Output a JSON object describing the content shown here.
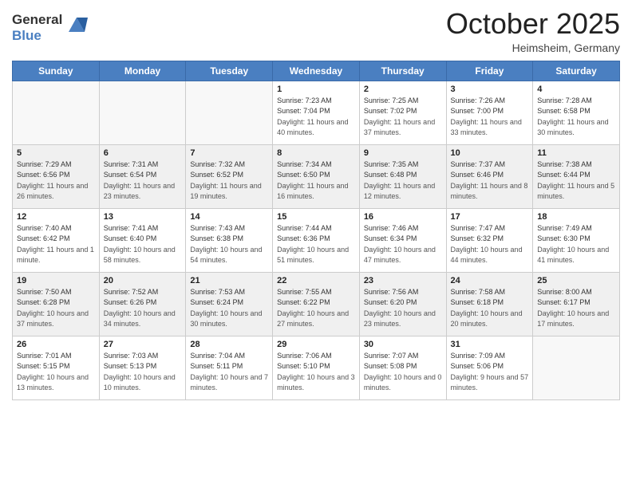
{
  "header": {
    "logo_line1": "General",
    "logo_line2": "Blue",
    "title": "October 2025",
    "subtitle": "Heimsheim, Germany"
  },
  "days_of_week": [
    "Sunday",
    "Monday",
    "Tuesday",
    "Wednesday",
    "Thursday",
    "Friday",
    "Saturday"
  ],
  "weeks": [
    [
      {
        "day": "",
        "info": ""
      },
      {
        "day": "",
        "info": ""
      },
      {
        "day": "",
        "info": ""
      },
      {
        "day": "1",
        "info": "Sunrise: 7:23 AM\nSunset: 7:04 PM\nDaylight: 11 hours and 40 minutes."
      },
      {
        "day": "2",
        "info": "Sunrise: 7:25 AM\nSunset: 7:02 PM\nDaylight: 11 hours and 37 minutes."
      },
      {
        "day": "3",
        "info": "Sunrise: 7:26 AM\nSunset: 7:00 PM\nDaylight: 11 hours and 33 minutes."
      },
      {
        "day": "4",
        "info": "Sunrise: 7:28 AM\nSunset: 6:58 PM\nDaylight: 11 hours and 30 minutes."
      }
    ],
    [
      {
        "day": "5",
        "info": "Sunrise: 7:29 AM\nSunset: 6:56 PM\nDaylight: 11 hours and 26 minutes."
      },
      {
        "day": "6",
        "info": "Sunrise: 7:31 AM\nSunset: 6:54 PM\nDaylight: 11 hours and 23 minutes."
      },
      {
        "day": "7",
        "info": "Sunrise: 7:32 AM\nSunset: 6:52 PM\nDaylight: 11 hours and 19 minutes."
      },
      {
        "day": "8",
        "info": "Sunrise: 7:34 AM\nSunset: 6:50 PM\nDaylight: 11 hours and 16 minutes."
      },
      {
        "day": "9",
        "info": "Sunrise: 7:35 AM\nSunset: 6:48 PM\nDaylight: 11 hours and 12 minutes."
      },
      {
        "day": "10",
        "info": "Sunrise: 7:37 AM\nSunset: 6:46 PM\nDaylight: 11 hours and 8 minutes."
      },
      {
        "day": "11",
        "info": "Sunrise: 7:38 AM\nSunset: 6:44 PM\nDaylight: 11 hours and 5 minutes."
      }
    ],
    [
      {
        "day": "12",
        "info": "Sunrise: 7:40 AM\nSunset: 6:42 PM\nDaylight: 11 hours and 1 minute."
      },
      {
        "day": "13",
        "info": "Sunrise: 7:41 AM\nSunset: 6:40 PM\nDaylight: 10 hours and 58 minutes."
      },
      {
        "day": "14",
        "info": "Sunrise: 7:43 AM\nSunset: 6:38 PM\nDaylight: 10 hours and 54 minutes."
      },
      {
        "day": "15",
        "info": "Sunrise: 7:44 AM\nSunset: 6:36 PM\nDaylight: 10 hours and 51 minutes."
      },
      {
        "day": "16",
        "info": "Sunrise: 7:46 AM\nSunset: 6:34 PM\nDaylight: 10 hours and 47 minutes."
      },
      {
        "day": "17",
        "info": "Sunrise: 7:47 AM\nSunset: 6:32 PM\nDaylight: 10 hours and 44 minutes."
      },
      {
        "day": "18",
        "info": "Sunrise: 7:49 AM\nSunset: 6:30 PM\nDaylight: 10 hours and 41 minutes."
      }
    ],
    [
      {
        "day": "19",
        "info": "Sunrise: 7:50 AM\nSunset: 6:28 PM\nDaylight: 10 hours and 37 minutes."
      },
      {
        "day": "20",
        "info": "Sunrise: 7:52 AM\nSunset: 6:26 PM\nDaylight: 10 hours and 34 minutes."
      },
      {
        "day": "21",
        "info": "Sunrise: 7:53 AM\nSunset: 6:24 PM\nDaylight: 10 hours and 30 minutes."
      },
      {
        "day": "22",
        "info": "Sunrise: 7:55 AM\nSunset: 6:22 PM\nDaylight: 10 hours and 27 minutes."
      },
      {
        "day": "23",
        "info": "Sunrise: 7:56 AM\nSunset: 6:20 PM\nDaylight: 10 hours and 23 minutes."
      },
      {
        "day": "24",
        "info": "Sunrise: 7:58 AM\nSunset: 6:18 PM\nDaylight: 10 hours and 20 minutes."
      },
      {
        "day": "25",
        "info": "Sunrise: 8:00 AM\nSunset: 6:17 PM\nDaylight: 10 hours and 17 minutes."
      }
    ],
    [
      {
        "day": "26",
        "info": "Sunrise: 7:01 AM\nSunset: 5:15 PM\nDaylight: 10 hours and 13 minutes."
      },
      {
        "day": "27",
        "info": "Sunrise: 7:03 AM\nSunset: 5:13 PM\nDaylight: 10 hours and 10 minutes."
      },
      {
        "day": "28",
        "info": "Sunrise: 7:04 AM\nSunset: 5:11 PM\nDaylight: 10 hours and 7 minutes."
      },
      {
        "day": "29",
        "info": "Sunrise: 7:06 AM\nSunset: 5:10 PM\nDaylight: 10 hours and 3 minutes."
      },
      {
        "day": "30",
        "info": "Sunrise: 7:07 AM\nSunset: 5:08 PM\nDaylight: 10 hours and 0 minutes."
      },
      {
        "day": "31",
        "info": "Sunrise: 7:09 AM\nSunset: 5:06 PM\nDaylight: 9 hours and 57 minutes."
      },
      {
        "day": "",
        "info": ""
      }
    ]
  ]
}
